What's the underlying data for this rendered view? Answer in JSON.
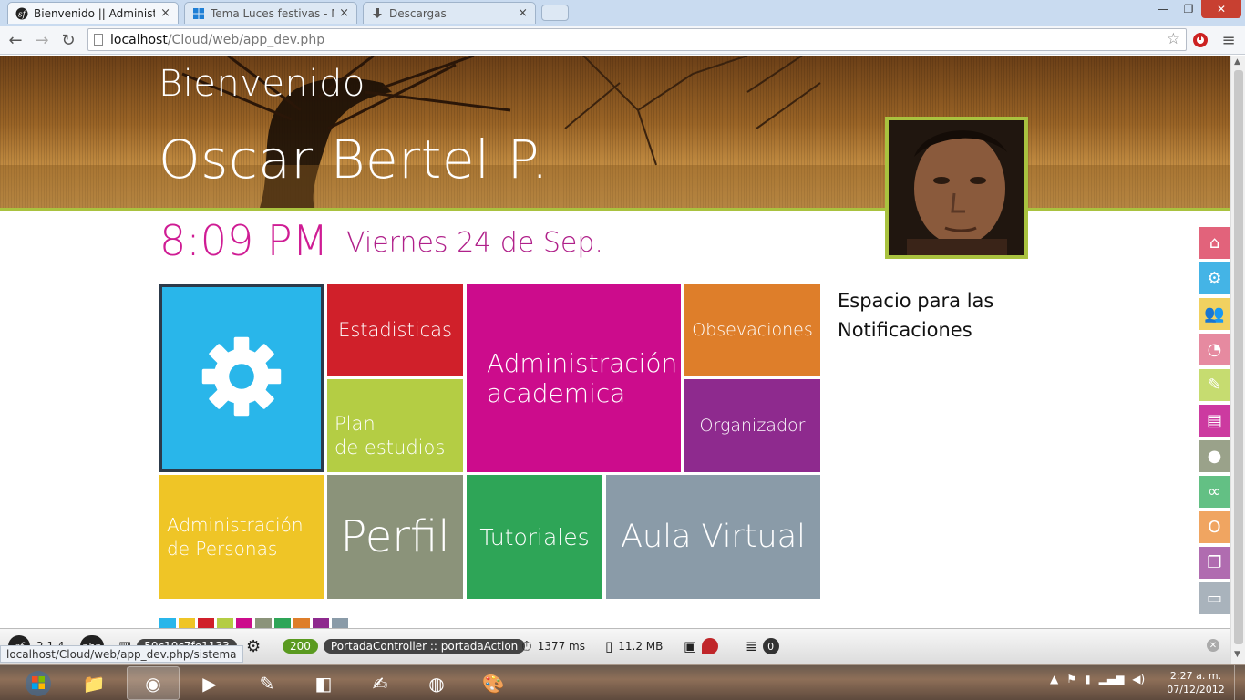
{
  "browser": {
    "tabs": [
      {
        "title": "Bienvenido || Administrad",
        "icon": "symfony-icon",
        "active": true
      },
      {
        "title": "Tema Luces festivas - Mic",
        "icon": "windows-icon",
        "active": false
      },
      {
        "title": "Descargas",
        "icon": "download-icon",
        "active": false
      }
    ],
    "close_glyph": "×",
    "window_controls": {
      "minimize": "—",
      "maximize": "❐",
      "close": "✕"
    },
    "nav": {
      "back": "←",
      "forward": "→",
      "reload": "↻",
      "menu": "≡"
    },
    "address": {
      "host": "localhost",
      "path": "/Cloud/web/app_dev.php"
    },
    "star": "☆"
  },
  "page": {
    "welcome": "Bienvenido",
    "user_name": "Oscar Bertel P.",
    "time": "8:09 PM",
    "date": "Viernes 24 de Sep.",
    "notifications_text": "Espacio para las Notificaciones",
    "tiles": [
      {
        "key": "config",
        "label": "",
        "icon": "gear-icon",
        "color": "#29b6ea"
      },
      {
        "key": "estadisticas",
        "label": "Estadisticas",
        "color": "#d0202a"
      },
      {
        "key": "plan",
        "label": "Plan de estudios",
        "lines": [
          "Plan",
          "de estudios"
        ],
        "color": "#b4cd44"
      },
      {
        "key": "admin-academica",
        "label": "Administración academica",
        "lines": [
          "Administración",
          "academica"
        ],
        "color": "#cc0c8c"
      },
      {
        "key": "observaciones",
        "label": "Obsevaciones",
        "color": "#de7e2a"
      },
      {
        "key": "organizador",
        "label": "Organizador",
        "color": "#8e2a8e"
      },
      {
        "key": "admin-personas",
        "label": "Administración de Personas",
        "lines": [
          "Administración",
          "de Personas"
        ],
        "color": "#efc526"
      },
      {
        "key": "perfil",
        "label": "Perfil",
        "color": "#8b937a"
      },
      {
        "key": "tutoriales",
        "label": "Tutoriales",
        "color": "#2ea557"
      },
      {
        "key": "aula-virtual",
        "label": "Aula Virtual",
        "color": "#8a9ba8"
      }
    ],
    "swatches": [
      "#29b6ea",
      "#efc526",
      "#d0202a",
      "#b4cd44",
      "#cc0c8c",
      "#8b937a",
      "#2ea557",
      "#de7e2a",
      "#8e2a8e",
      "#8a9ba8"
    ],
    "side_icons": [
      {
        "name": "home-icon",
        "glyph": "⌂",
        "color": "#e2637b"
      },
      {
        "name": "gear-icon",
        "glyph": "⚙",
        "color": "#44b4e6"
      },
      {
        "name": "users-icon",
        "glyph": "👥",
        "color": "#f1d160"
      },
      {
        "name": "pie-chart-icon",
        "glyph": "◔",
        "color": "#e68aa0"
      },
      {
        "name": "notebook-icon",
        "glyph": "✎",
        "color": "#c6dc70"
      },
      {
        "name": "document-icon",
        "glyph": "▤",
        "color": "#cc3aa0"
      },
      {
        "name": "person-icon",
        "glyph": "●",
        "color": "#9aa28a"
      },
      {
        "name": "fish-icon",
        "glyph": "∞",
        "color": "#63c084"
      },
      {
        "name": "circle-icon",
        "glyph": "O",
        "color": "#f0a561"
      },
      {
        "name": "windows-stack-icon",
        "glyph": "❐",
        "color": "#b06cb0"
      },
      {
        "name": "window-icon",
        "glyph": "▭",
        "color": "#a9b3bc"
      }
    ]
  },
  "debug_toolbar": {
    "sf_version": "2.1.4",
    "php_label": "php",
    "token": "50c10c7fe1133",
    "status_code": "200",
    "controller": "PortadaController :: portadaAction",
    "controller_class": "PortadaController",
    "controller_action": "portadaAction",
    "time": "1377 ms",
    "memory": "11.2 MB",
    "db_count": "0",
    "status_link": "localhost/Cloud/web/app_dev.php/sistema"
  },
  "taskbar": {
    "clock_time": "2:27 a. m.",
    "clock_date": "07/12/2012",
    "apps": [
      {
        "name": "explorer-icon",
        "glyph": "📁",
        "active": false
      },
      {
        "name": "chrome-icon",
        "glyph": "◉",
        "active": true
      },
      {
        "name": "media-player-icon",
        "glyph": "▶",
        "active": false
      },
      {
        "name": "notepad-icon",
        "glyph": "✎",
        "active": false
      },
      {
        "name": "blue-app-icon",
        "glyph": "◧",
        "active": false
      },
      {
        "name": "notepadpp-icon",
        "glyph": "✍",
        "active": false
      },
      {
        "name": "firefox-icon",
        "glyph": "◍",
        "active": false
      },
      {
        "name": "paint-icon",
        "glyph": "🎨",
        "active": false
      }
    ]
  }
}
